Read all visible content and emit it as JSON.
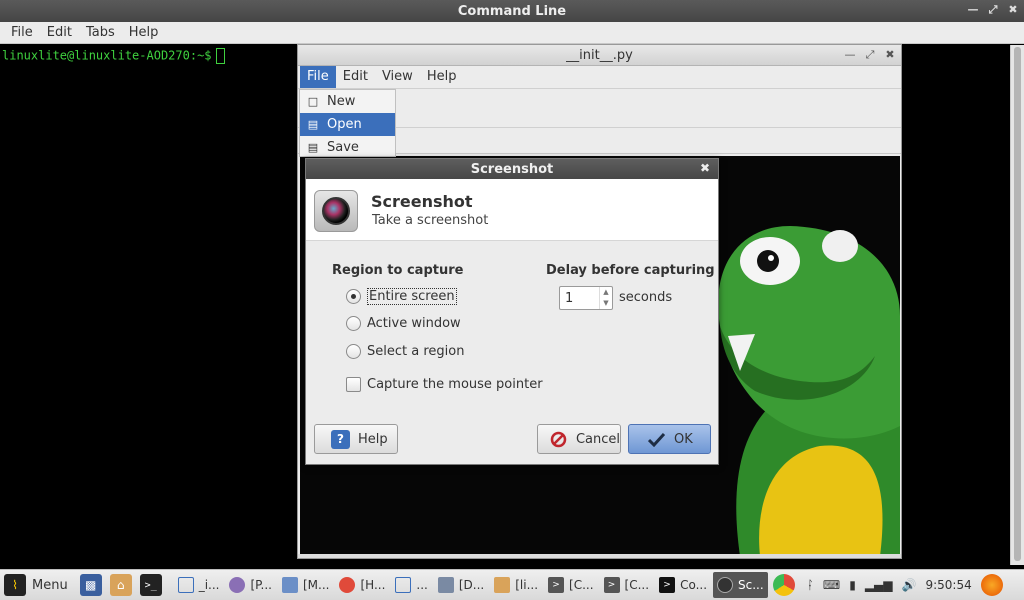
{
  "terminal": {
    "title": "Command Line",
    "menu": [
      "File",
      "Edit",
      "Tabs",
      "Help"
    ],
    "prompt": "linuxlite@linuxlite-AOD270:~$"
  },
  "viewer": {
    "title": "__init__.py",
    "menu": [
      "File",
      "Edit",
      "View",
      "Help"
    ],
    "file_menu": [
      "New",
      "Open",
      "Save"
    ]
  },
  "dialog": {
    "title": "Screenshot",
    "header_title": "Screenshot",
    "header_subtitle": "Take a screenshot",
    "region_label": "Region to capture",
    "region_options": [
      "Entire screen",
      "Active window",
      "Select a region"
    ],
    "mouse_pointer_label": "Capture the mouse pointer",
    "delay_label": "Delay before capturing",
    "delay_value": "1",
    "delay_unit": "seconds",
    "help_label": "Help",
    "cancel_label": "Cancel",
    "ok_label": "OK"
  },
  "taskbar": {
    "menu_label": "Menu",
    "tasks": [
      "_i...",
      "[P...",
      "[M...",
      "[H...",
      "...",
      "[D...",
      "[li...",
      "[C...",
      "[C...",
      "Co...",
      "Sc..."
    ],
    "clock": "9:50:54"
  },
  "colors": {
    "terminal_text": "#3fd13f",
    "menu_highlight": "#3b6fbb",
    "ok_button": "#6f97d4"
  }
}
